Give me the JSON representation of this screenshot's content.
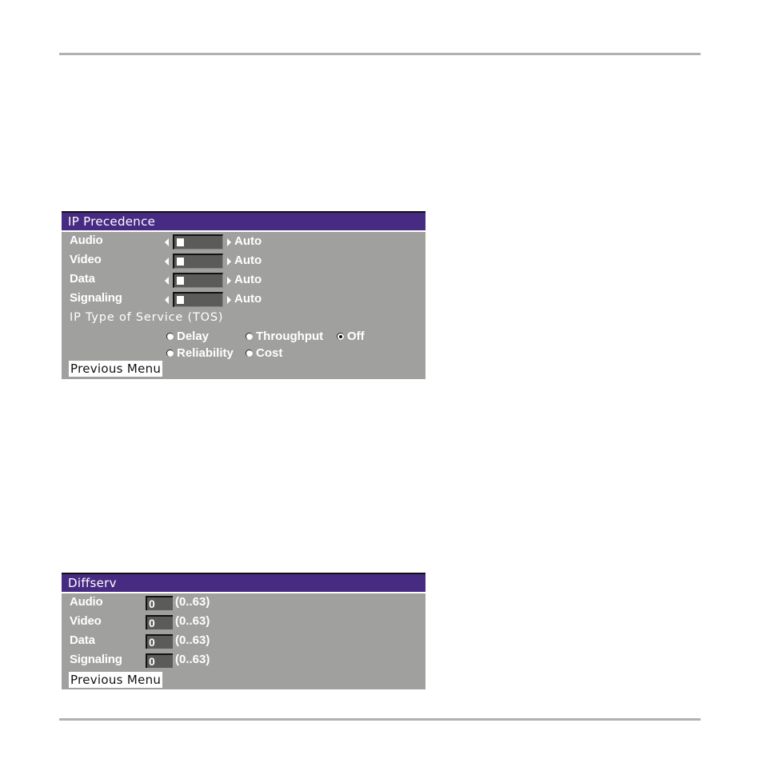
{
  "ip_precedence": {
    "title": "IP Precedence",
    "rows": [
      {
        "label": "Audio",
        "value": "Auto",
        "position": 0
      },
      {
        "label": "Video",
        "value": "Auto",
        "position": 0
      },
      {
        "label": "Data",
        "value": "Auto",
        "position": 0
      },
      {
        "label": "Signaling",
        "value": "Auto",
        "position": 0
      }
    ],
    "tos": {
      "title": "IP Type of Service (TOS)",
      "options": [
        {
          "label": "Delay",
          "selected": false
        },
        {
          "label": "Throughput",
          "selected": false
        },
        {
          "label": "Off",
          "selected": true
        },
        {
          "label": "Reliability",
          "selected": false
        },
        {
          "label": "Cost",
          "selected": false
        }
      ]
    },
    "previous_menu": "Previous Menu"
  },
  "diffserv": {
    "title": "Diffserv",
    "rows": [
      {
        "label": "Audio",
        "value": "0",
        "range": "(0..63)"
      },
      {
        "label": "Video",
        "value": "0",
        "range": "(0..63)"
      },
      {
        "label": "Data",
        "value": "0",
        "range": "(0..63)"
      },
      {
        "label": "Signaling",
        "value": "0",
        "range": "(0..63)"
      }
    ],
    "previous_menu": "Previous Menu"
  },
  "colors": {
    "header": "#472b83",
    "panel": "#a0a09e",
    "field": "#5b5b59"
  }
}
